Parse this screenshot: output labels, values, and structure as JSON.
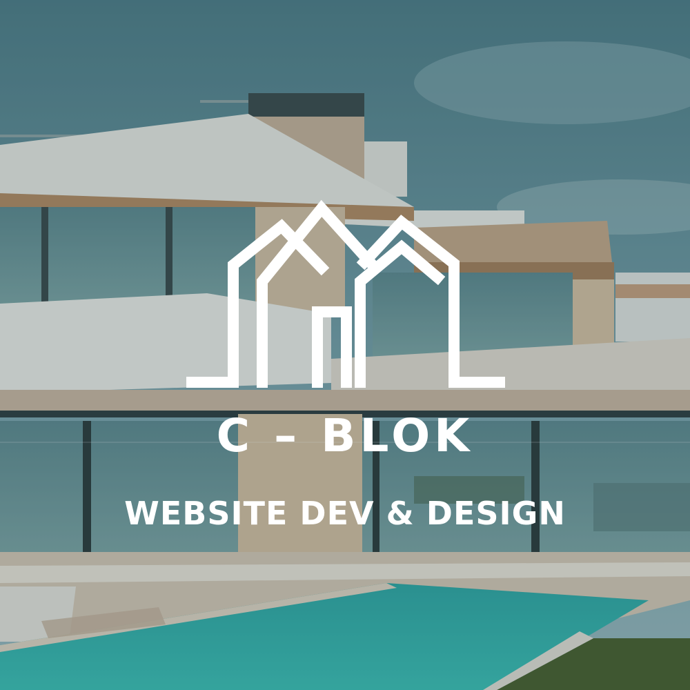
{
  "brand": {
    "name": "C – BLOK",
    "tagline": "WEBSITE DEV & DESIGN",
    "logo_icon": "three-houses-outline-icon"
  },
  "colors": {
    "text": "#ffffff",
    "sky": "#6f9aa5",
    "pool": "#3fb3b0",
    "wall": "#e9e7e0",
    "wood": "#b08a66"
  }
}
